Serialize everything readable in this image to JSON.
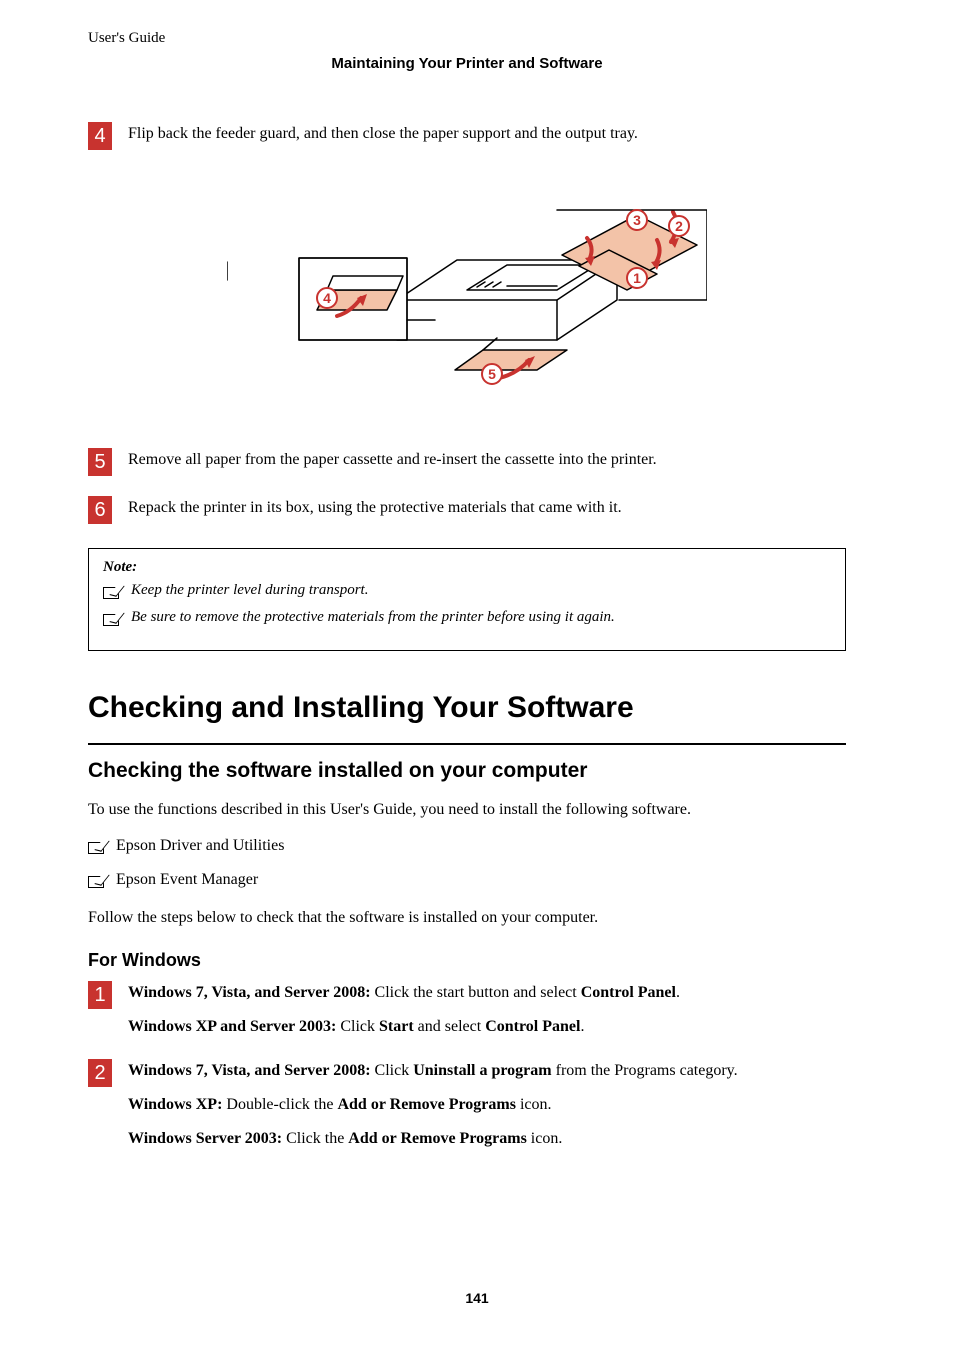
{
  "header": {
    "guide": "User's Guide",
    "section": "Maintaining Your Printer and Software"
  },
  "steps_top": [
    {
      "num": "4",
      "text": "Flip back the feeder guard, and then close the paper support and the output tray."
    },
    {
      "num": "5",
      "text": "Remove all paper from the paper cassette and re-insert the cassette into the printer."
    },
    {
      "num": "6",
      "text": "Repack the printer in its box, using the protective materials that came with it."
    }
  ],
  "note": {
    "label": "Note:",
    "items": [
      "Keep the printer level during transport.",
      "Be sure to remove the protective materials from the printer before using it again."
    ]
  },
  "h1": "Checking and Installing Your Software",
  "h2": "Checking the software installed on your computer",
  "intro": "To use the functions described in this User's Guide, you need to install the following software.",
  "software": [
    "Epson Driver and Utilities",
    "Epson Event Manager"
  ],
  "follow": "Follow the steps below to check that the software is installed on your computer.",
  "h3": "For Windows",
  "win_steps": [
    {
      "num": "1",
      "lines": [
        {
          "b1": "Windows 7, Vista, and Server 2008:",
          "t1": " Click the start button and select ",
          "b2": "Control Panel",
          "t2": "."
        },
        {
          "b1": "Windows XP and Server 2003:",
          "t1": " Click ",
          "b2": "Start",
          "t2": " and select ",
          "b3": "Control Panel",
          "t3": "."
        }
      ]
    },
    {
      "num": "2",
      "lines": [
        {
          "b1": "Windows 7, Vista, and Server 2008:",
          "t1": " Click ",
          "b2": "Uninstall a program",
          "t2": " from the Programs category."
        },
        {
          "b1": "Windows XP:",
          "t1": " Double-click the ",
          "b2": "Add or Remove Programs",
          "t2": " icon."
        },
        {
          "b1": "Windows Server 2003:",
          "t1": " Click the ",
          "b2": "Add or Remove Programs",
          "t2": " icon."
        }
      ]
    }
  ],
  "page_number": "141",
  "illustration": {
    "callouts": [
      "1",
      "2",
      "3",
      "4",
      "5"
    ]
  }
}
